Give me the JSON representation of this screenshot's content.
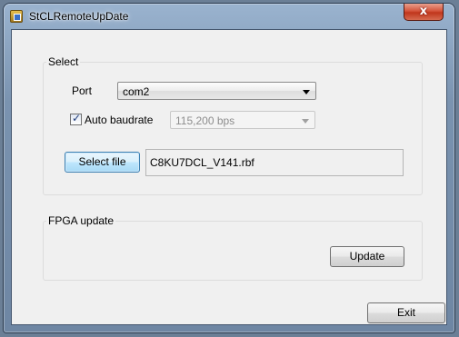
{
  "window": {
    "title": "StCLRemoteUpDate",
    "close_glyph": "x"
  },
  "select_group": {
    "label": "Select",
    "port_label": "Port",
    "port_value": "com2",
    "auto_baudrate_label": "Auto baudrate",
    "auto_baudrate_checked": true,
    "baudrate_value": "115,200  bps",
    "select_file_label": "Select file",
    "file_path": "C8KU7DCL_V141.rbf"
  },
  "fpga_group": {
    "label": "FPGA update",
    "update_label": "Update"
  },
  "footer": {
    "exit_label": "Exit"
  },
  "icons": {
    "app": "app-icon",
    "close": "close-icon",
    "dropdown": "chevron-down-icon",
    "check": "checkmark-icon"
  },
  "colors": {
    "focus_blue": "#3c7fb1",
    "close_red": "#c0361c",
    "dialog_bg": "#f0f0f0"
  }
}
